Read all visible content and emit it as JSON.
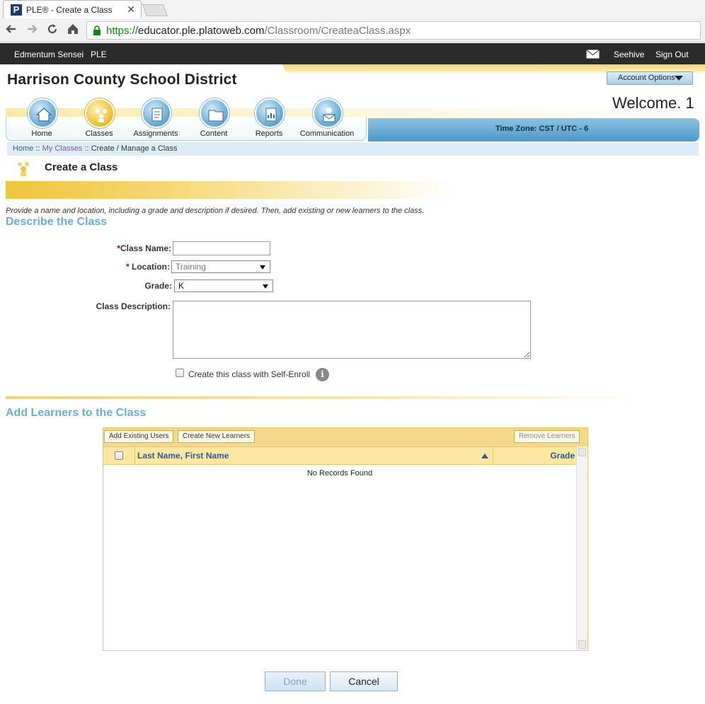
{
  "browser": {
    "tab_title": "PLE® - Create a Class",
    "tab_close": "✕",
    "favicon_letter": "P",
    "url_scheme": "https://",
    "url_host": "educator.ple.platoweb.com",
    "url_path": "/Classroom/CreateaClass.aspx"
  },
  "topbar": {
    "brand": "Edmentum Sensei",
    "app": "PLE",
    "user": "Seehive",
    "signout": "Sign Out"
  },
  "header": {
    "district": "Harrison County School District",
    "account_options": "Account Options",
    "welcome": "Welcome, 1",
    "timezone": "Time Zone: CST / UTC - 6"
  },
  "nav": {
    "items": [
      {
        "label": "Home",
        "icon": "home-icon",
        "active": false
      },
      {
        "label": "Classes",
        "icon": "classes-icon",
        "active": true
      },
      {
        "label": "Assignments",
        "icon": "assignments-icon",
        "active": false
      },
      {
        "label": "Content",
        "icon": "content-icon",
        "active": false
      },
      {
        "label": "Reports",
        "icon": "reports-icon",
        "active": false
      },
      {
        "label": "Communication",
        "icon": "communication-icon",
        "active": false
      }
    ]
  },
  "breadcrumb": {
    "home": "Home",
    "sep": "::",
    "my_classes": "My Classes",
    "current": "Create / Manage a Class"
  },
  "page": {
    "title": "Create a Class",
    "intro": "Provide a name and location, including a grade and description if desired. Then, add existing or new learners to the class."
  },
  "describe": {
    "heading": "Describe the Class",
    "class_name_label": "Class Name:",
    "class_name_value": "",
    "location_label": "Location:",
    "location_value": "Training",
    "grade_label": "Grade:",
    "grade_value": "K",
    "description_label": "Class Description:",
    "description_value": "",
    "self_enroll_label": "Create this class with Self-Enroll",
    "required_mark": "*"
  },
  "learners": {
    "heading": "Add Learners to the Class",
    "add_existing": "Add Existing Users",
    "create_new": "Create New Learners",
    "remove": "Remove Learners",
    "col_name": "Last Name, First Name",
    "col_grade": "Grade",
    "empty": "No Records Found"
  },
  "footer": {
    "done": "Done",
    "cancel": "Cancel"
  },
  "colors": {
    "accent_blue": "#6aaed6",
    "gold": "#f0c53e",
    "topbar": "#2b2b2b",
    "link": "#2a6496"
  }
}
